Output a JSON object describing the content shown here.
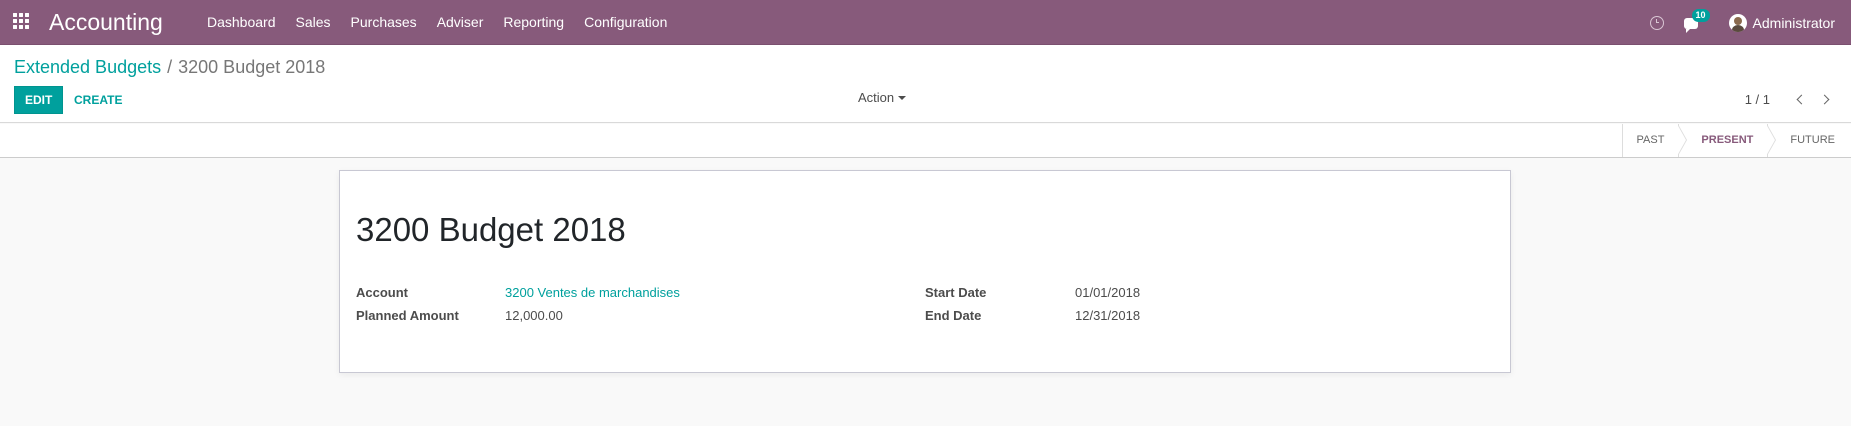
{
  "navbar": {
    "app_title": "Accounting",
    "menu": [
      "Dashboard",
      "Sales",
      "Purchases",
      "Adviser",
      "Reporting",
      "Configuration"
    ],
    "chat_badge": "10",
    "user_name": "Administrator",
    "color": "#875a7b"
  },
  "control_panel": {
    "breadcrumb_parent": "Extended Budgets",
    "breadcrumb_separator": "/",
    "breadcrumb_current": "3200 Budget 2018",
    "edit_label": "EDIT",
    "create_label": "CREATE",
    "action_label": "Action",
    "pager": "1 / 1"
  },
  "statusbar": {
    "stages": [
      "PAST",
      "PRESENT",
      "FUTURE"
    ],
    "active_stage": "PRESENT"
  },
  "form": {
    "title": "3200 Budget 2018",
    "account_label": "Account",
    "account_value": "3200 Ventes de marchandises",
    "planned_amount_label": "Planned Amount",
    "planned_amount_value": "12,000.00",
    "start_date_label": "Start Date",
    "start_date_value": "01/01/2018",
    "end_date_label": "End Date",
    "end_date_value": "12/31/2018"
  },
  "colors": {
    "accent": "#00a09d",
    "brand": "#875a7b"
  }
}
